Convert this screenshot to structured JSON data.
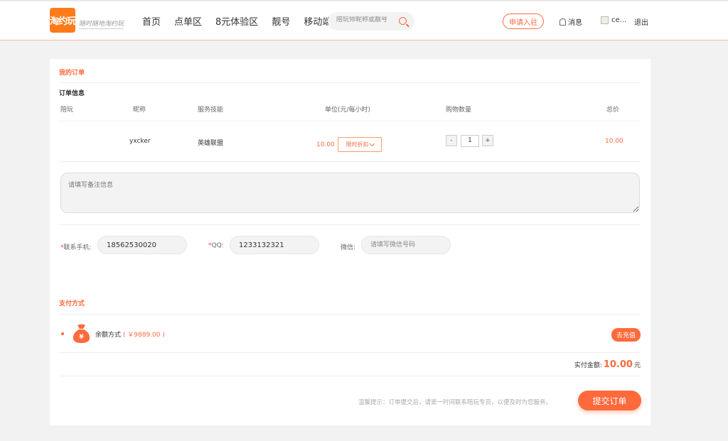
{
  "header": {
    "logo_text": "淘约玩",
    "slogan": "随时随地淘约玩",
    "nav": [
      "首页",
      "点单区",
      "8元体验区",
      "靓号",
      "移动端"
    ],
    "search_placeholder": "陪玩师昵称或靓号",
    "apply_label": "申请入驻",
    "message_label": "消息",
    "username": "ce...",
    "logout_label": "退出"
  },
  "order": {
    "section_title": "我的订单",
    "info_title": "订单信息",
    "columns": [
      "陪玩",
      "昵称",
      "服务技能",
      "单位(元/每小时)",
      "购物数量",
      "总价"
    ],
    "row": {
      "nickname": "yxcker",
      "skill": "英雄联盟",
      "unit_price": "10.00",
      "discount_label": "限时折扣",
      "quantity": "1",
      "minus": "-",
      "plus": "+",
      "total": "10.00"
    },
    "remark_placeholder": "请填写备注信息",
    "contact": {
      "phone_label": "联系手机:",
      "phone_value": "18562530020",
      "qq_label": "QQ:",
      "qq_value": "1233132321",
      "wechat_label": "微信:",
      "wechat_placeholder": "请填写微信号码",
      "required_mark": "*"
    }
  },
  "payment": {
    "section_title": "支付方式",
    "method_label": "余额方式",
    "balance": "( ￥9889.00 )",
    "recharge_label": "去充值",
    "total_label": "实付金额:",
    "total_amount": "10.00",
    "total_unit": "元",
    "tip": "温馨提示：订单提交后，请第一时间联系陪玩专员，以便及时为您服务。",
    "submit_label": "提交订单"
  },
  "colors": {
    "accent": "#ff6a3d",
    "logo": "#ff7a1a"
  }
}
